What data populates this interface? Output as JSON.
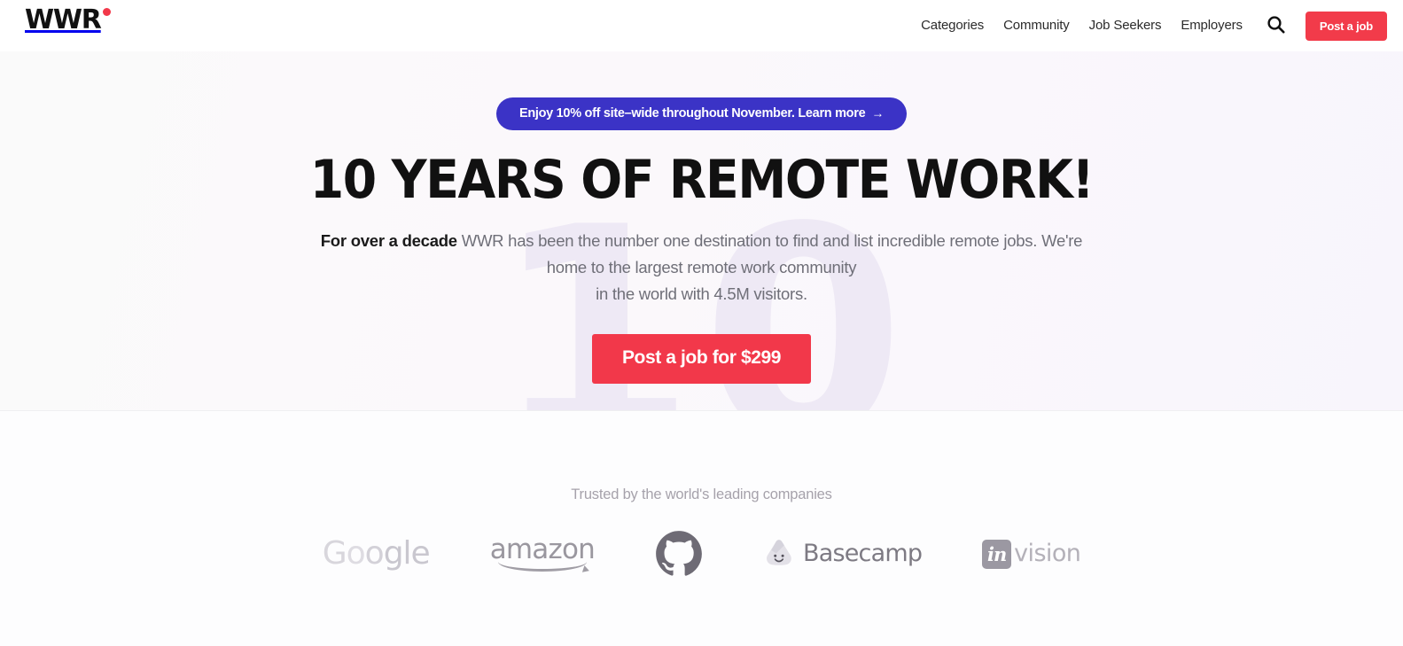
{
  "header": {
    "logo": {
      "text": "WWR",
      "dot_color": "#f2384a"
    },
    "nav_items": [
      {
        "label": "Categories"
      },
      {
        "label": "Community"
      },
      {
        "label": "Job Seekers"
      },
      {
        "label": "Employers"
      }
    ],
    "search_icon": "search-icon",
    "post_job_label": "Post a job",
    "post_job_color": "#f23b4a"
  },
  "hero": {
    "promo": {
      "text": "Enjoy 10% off site–wide throughout November. Learn more",
      "arrow": "→",
      "background": "#3b33c6"
    },
    "title": "10 YEARS OF REMOTE WORK!",
    "subtitle_bold": "For over a decade",
    "subtitle_line1": " WWR has been the number one destination to find and list incredible remote jobs. We're",
    "subtitle_line2": "home to the largest remote work community",
    "subtitle_line3": "in the world with 4.5M visitors.",
    "cta_label": "Post a job for $299",
    "cta_color": "#f2384a",
    "watermark": "10"
  },
  "trusted": {
    "label": "Trusted by the world's leading companies",
    "brands": [
      {
        "name": "Google",
        "g1": "G",
        "o1": "o",
        "o2": "o",
        "rest": "gle"
      },
      {
        "name": "amazon",
        "wordmark": "amazon"
      },
      {
        "name": "GitHub",
        "wordmark": ""
      },
      {
        "name": "Basecamp",
        "wordmark": "Basecamp"
      },
      {
        "name": "InVision",
        "box": "in",
        "wordmark": "vision"
      }
    ]
  }
}
